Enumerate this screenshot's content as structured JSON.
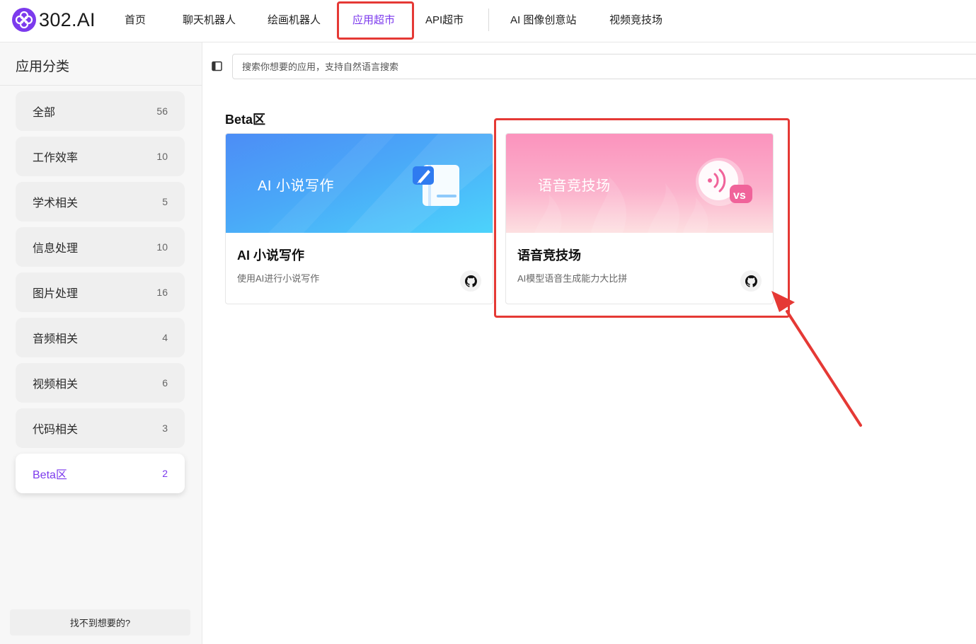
{
  "brand": {
    "name": "302.AI",
    "accent": "#7c3aed"
  },
  "nav": {
    "items": [
      {
        "label": "首页"
      },
      {
        "label": "聊天机器人"
      },
      {
        "label": "绘画机器人"
      },
      {
        "label": "应用超市",
        "active": true
      },
      {
        "label": "API超市"
      },
      {
        "label": "AI 图像创意站"
      },
      {
        "label": "视频竞技场"
      }
    ]
  },
  "sidebar": {
    "title": "应用分类",
    "categories": [
      {
        "label": "全部",
        "count": "56"
      },
      {
        "label": "工作效率",
        "count": "10"
      },
      {
        "label": "学术相关",
        "count": "5"
      },
      {
        "label": "信息处理",
        "count": "10"
      },
      {
        "label": "图片处理",
        "count": "16"
      },
      {
        "label": "音频相关",
        "count": "4"
      },
      {
        "label": "视频相关",
        "count": "6"
      },
      {
        "label": "代码相关",
        "count": "3"
      },
      {
        "label": "Beta区",
        "count": "2",
        "active": true
      }
    ],
    "help_label": "找不到想要的?"
  },
  "search": {
    "placeholder": "搜索你想要的应用，支持自然语言搜索"
  },
  "section": {
    "title": "Beta区"
  },
  "cards": [
    {
      "banner_text": "AI 小说写作",
      "title": "AI 小说写作",
      "desc": "使用AI进行小说写作",
      "icon": "book-pen-icon"
    },
    {
      "banner_text": "语音竞技场",
      "title": "语音竞技场",
      "desc": "AI模型语音生成能力大比拼",
      "icon": "voice-vs-icon"
    }
  ],
  "annotation": {
    "color": "#e53935"
  }
}
